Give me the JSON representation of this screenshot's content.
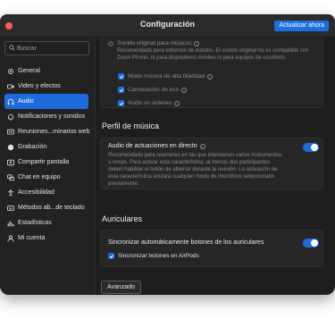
{
  "window": {
    "title": "Configuración",
    "update_button": "Actualizar ahora"
  },
  "search": {
    "placeholder": "Buscar"
  },
  "sidebar": {
    "items": [
      {
        "label": "General",
        "icon": "gear-icon"
      },
      {
        "label": "Video y efectos",
        "icon": "video-camera-icon"
      },
      {
        "label": "Audio",
        "icon": "headphones-icon",
        "active": true
      },
      {
        "label": "Notificaciones y sonidos",
        "icon": "bell-icon"
      },
      {
        "label": "Reuniones...minarios web",
        "icon": "meetings-icon"
      },
      {
        "label": "Grabación",
        "icon": "record-icon"
      },
      {
        "label": "Compartir pantalla",
        "icon": "share-screen-icon"
      },
      {
        "label": "Chat en equipo",
        "icon": "chat-bubbles-icon"
      },
      {
        "label": "Accesibilidad",
        "icon": "accessibility-icon"
      },
      {
        "label": "Métodos ab...de teclado",
        "icon": "keyboard-icon"
      },
      {
        "label": "Estadísticas",
        "icon": "bar-chart-icon"
      },
      {
        "label": "Mi cuenta",
        "icon": "person-icon"
      }
    ]
  },
  "original_sound": {
    "label": "Sonido original para músicos",
    "description": "Recomendado para entornos de estudio. El sonido original no es compatible con Zoom Phone, ni para dispositivos móviles ni para equipos de escritorio.",
    "options": [
      {
        "label": "Modo música de alta fidelidad",
        "checked": true
      },
      {
        "label": "Cancelación de eco",
        "checked": true
      },
      {
        "label": "Audio en estéreo",
        "checked": true
      }
    ]
  },
  "music_profile": {
    "title": "Perfil de música",
    "live_performance_label": "Audio de actuaciones en directo",
    "live_performance_description": "Recomendado para reuniones en las que intervienen varios instrumentos o voces. Para activar esta característica, al menos dos participantes deben habilitar el botón de alternar durante la reunión. La activación de esta característica anulará cualquier modo de micrófono seleccionado previamente.",
    "live_performance_on": true
  },
  "headphones": {
    "title": "Auriculares",
    "auto_sync_label": "Sincronizar automáticamente botones de los auriculares",
    "auto_sync_on": true,
    "airpods_label": "Sincronizar botones en AirPods",
    "airpods_checked": true
  },
  "advanced_button": "Avanzado",
  "colors": {
    "accent": "#1f6bdc",
    "close": "#ff5f57",
    "background": "#1e1e1e"
  }
}
